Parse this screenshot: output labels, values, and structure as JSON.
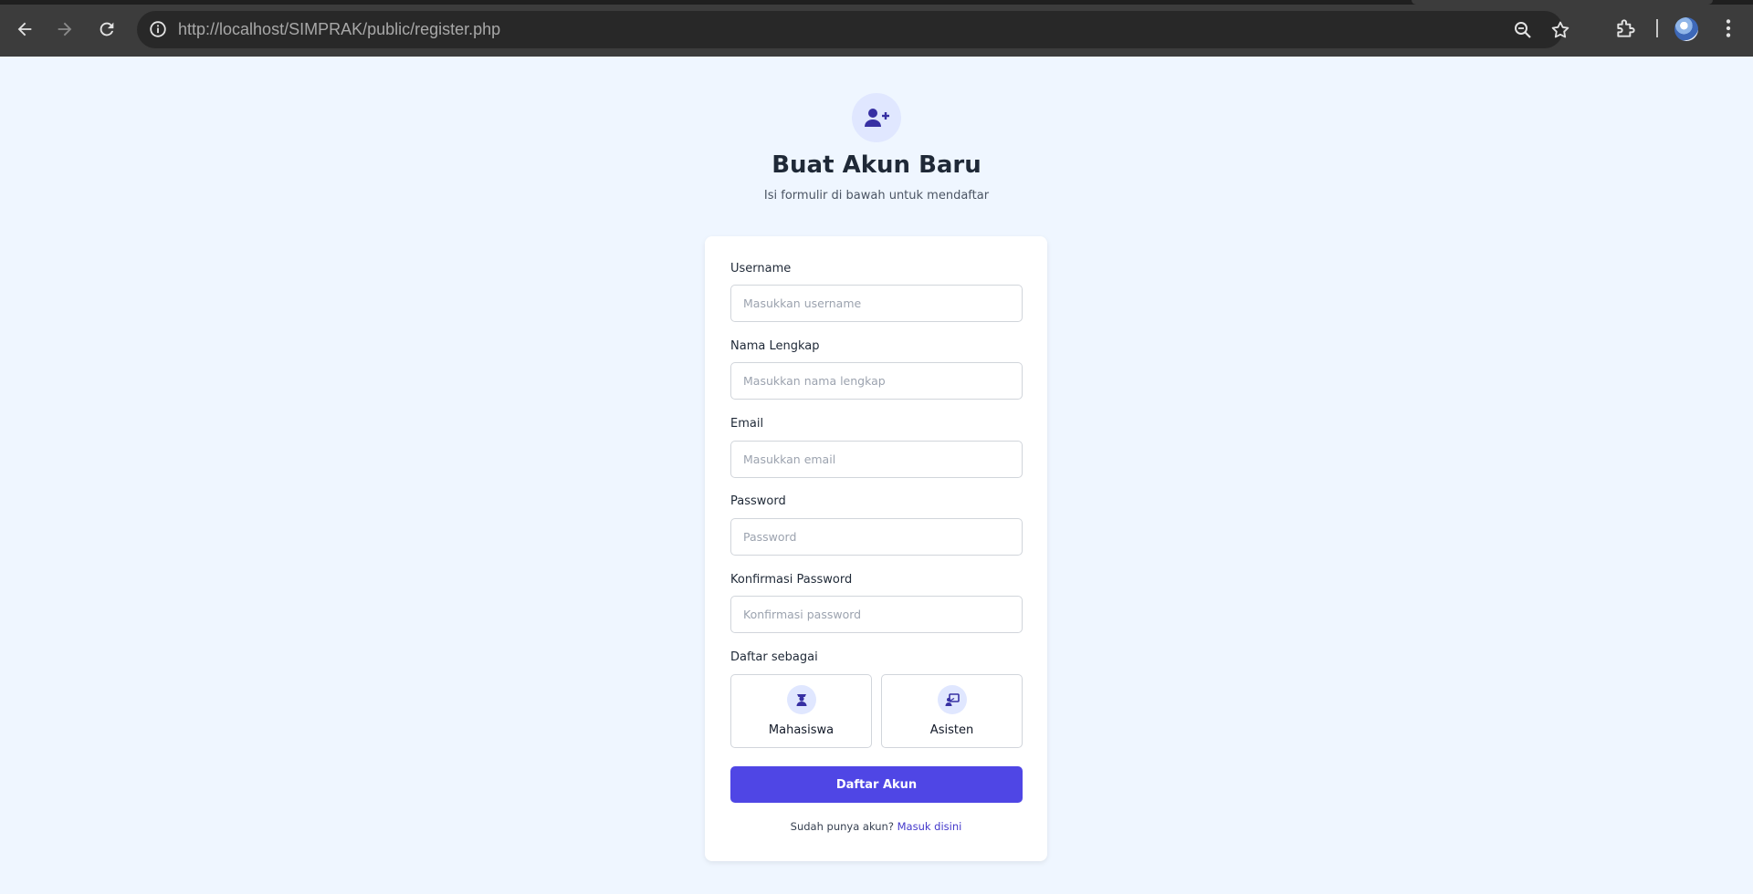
{
  "browser": {
    "url": "http://localhost/SIMPRAK/public/register.php",
    "icons": [
      "back-icon",
      "forward-icon",
      "reload-icon",
      "site-info-icon",
      "zoom-icon",
      "bookmark-star-icon",
      "extensions-icon",
      "profile-avatar",
      "more-menu-icon"
    ]
  },
  "header": {
    "icon": "user-plus-icon",
    "title": "Buat Akun Baru",
    "subtitle": "Isi formulir di bawah untuk mendaftar"
  },
  "form": {
    "fields": [
      {
        "label": "Username",
        "placeholder": "Masukkan username",
        "value": ""
      },
      {
        "label": "Nama Lengkap",
        "placeholder": "Masukkan nama lengkap",
        "value": ""
      },
      {
        "label": "Email",
        "placeholder": "Masukkan email",
        "value": ""
      },
      {
        "label": "Password",
        "placeholder": "Password",
        "value": ""
      },
      {
        "label": "Konfirmasi Password",
        "placeholder": "Konfirmasi password",
        "value": ""
      }
    ],
    "role_label": "Daftar sebagai",
    "roles": [
      {
        "label": "Mahasiswa",
        "icon": "student-icon"
      },
      {
        "label": "Asisten",
        "icon": "teacher-icon"
      }
    ],
    "submit_label": "Daftar Akun",
    "login_prompt": "Sudah punya akun?",
    "login_link": "Masuk disini"
  },
  "colors": {
    "page_bg": "#eff6ff",
    "accent": "#4f46e5",
    "icon_bg": "#e0e7ff",
    "icon_fg": "#3730a3"
  }
}
